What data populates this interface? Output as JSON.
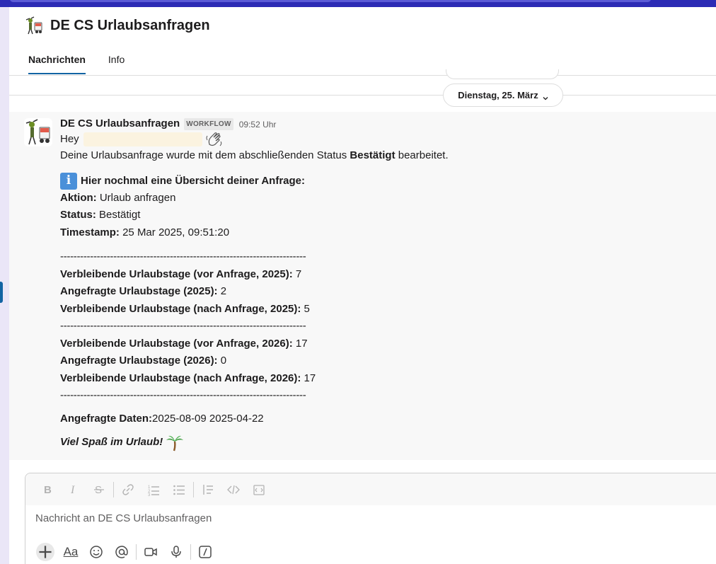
{
  "channel": {
    "name": "DE CS Urlaubsanfragen",
    "emoji_icon": "workflow-bot-icon"
  },
  "tabs": [
    {
      "label": "Nachrichten",
      "active": true
    },
    {
      "label": "Info",
      "active": false
    }
  ],
  "date_divider": {
    "label": "Dienstag, 25. März"
  },
  "message": {
    "sender": "DE CS Urlaubsanfragen",
    "badge": "WORKFLOW",
    "time": "09:52 Uhr",
    "greeting": "Hey",
    "status_line": {
      "prefix": "Deine Urlaubsanfrage wurde mit dem abschließenden Status ",
      "status": "Bestätigt",
      "suffix": " bearbeitet."
    },
    "overview_title": "Hier nochmal eine Übersicht deiner Anfrage:",
    "info_glyph": "i",
    "fields": [
      {
        "label": "Aktion:",
        "value": " Urlaub anfragen"
      },
      {
        "label": "Status:",
        "value": " Bestätigt"
      },
      {
        "label": "Timestamp:",
        "value": " 25 Mar 2025, 09:51:20"
      }
    ],
    "separator": "--------------------------------------------------------------------------",
    "block_2025": [
      {
        "label": "Verbleibende Urlaubstage (vor Anfrage, 2025):",
        "value": " 7"
      },
      {
        "label": "Angefragte Urlaubstage (2025):",
        "value": " 2"
      },
      {
        "label": "Verbleibende Urlaubstage (nach Anfrage, 2025):",
        "value": " 5"
      }
    ],
    "block_2026": [
      {
        "label": "Verbleibende Urlaubstage (vor Anfrage, 2026):",
        "value": " 17"
      },
      {
        "label": "Angefragte Urlaubstage (2026):",
        "value": " 0"
      },
      {
        "label": "Verbleibende Urlaubstage (nach Anfrage, 2026):",
        "value": " 17"
      }
    ],
    "dates": {
      "label": "Angefragte Daten:",
      "value": "2025-08-09 2025-04-22"
    },
    "closing": "Viel Spaß im Urlaub!"
  },
  "composer": {
    "placeholder": "Nachricht an DE CS Urlaubsanfragen",
    "format_tools": [
      "bold-icon",
      "italic-icon",
      "strikethrough-icon",
      "link-icon",
      "ordered-list-icon",
      "bulleted-list-icon",
      "blockquote-icon",
      "code-icon",
      "code-block-icon"
    ],
    "actions": [
      "plus-icon",
      "text-format-icon",
      "emoji-icon",
      "mention-icon",
      "video-icon",
      "microphone-icon",
      "slash-command-icon"
    ],
    "aa_label": "Aa"
  },
  "colors": {
    "accent": "#1264a3",
    "top_bar": "#2c2bb5",
    "message_bg": "#f8f8f8"
  }
}
